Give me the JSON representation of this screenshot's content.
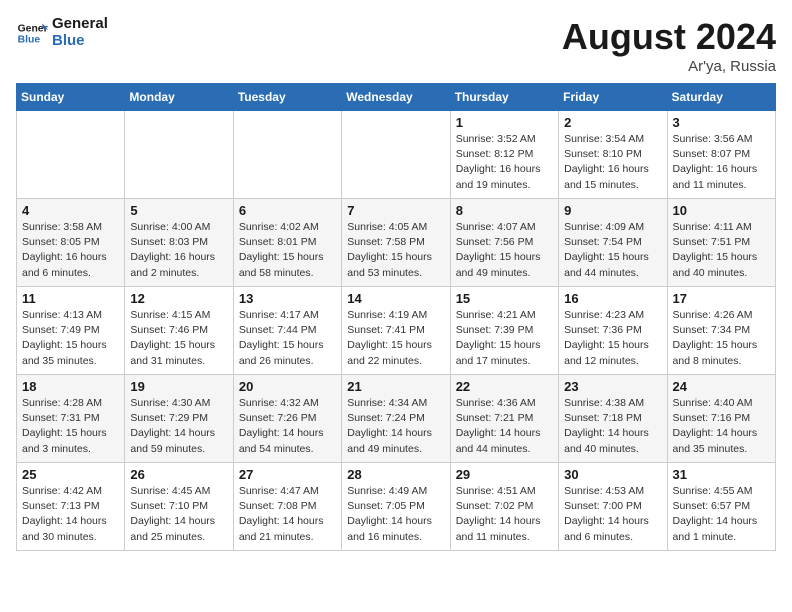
{
  "logo": {
    "line1": "General",
    "line2": "Blue"
  },
  "title": "August 2024",
  "subtitle": "Ar'ya, Russia",
  "weekdays": [
    "Sunday",
    "Monday",
    "Tuesday",
    "Wednesday",
    "Thursday",
    "Friday",
    "Saturday"
  ],
  "weeks": [
    [
      {
        "day": "",
        "info": ""
      },
      {
        "day": "",
        "info": ""
      },
      {
        "day": "",
        "info": ""
      },
      {
        "day": "",
        "info": ""
      },
      {
        "day": "1",
        "info": "Sunrise: 3:52 AM\nSunset: 8:12 PM\nDaylight: 16 hours\nand 19 minutes."
      },
      {
        "day": "2",
        "info": "Sunrise: 3:54 AM\nSunset: 8:10 PM\nDaylight: 16 hours\nand 15 minutes."
      },
      {
        "day": "3",
        "info": "Sunrise: 3:56 AM\nSunset: 8:07 PM\nDaylight: 16 hours\nand 11 minutes."
      }
    ],
    [
      {
        "day": "4",
        "info": "Sunrise: 3:58 AM\nSunset: 8:05 PM\nDaylight: 16 hours\nand 6 minutes."
      },
      {
        "day": "5",
        "info": "Sunrise: 4:00 AM\nSunset: 8:03 PM\nDaylight: 16 hours\nand 2 minutes."
      },
      {
        "day": "6",
        "info": "Sunrise: 4:02 AM\nSunset: 8:01 PM\nDaylight: 15 hours\nand 58 minutes."
      },
      {
        "day": "7",
        "info": "Sunrise: 4:05 AM\nSunset: 7:58 PM\nDaylight: 15 hours\nand 53 minutes."
      },
      {
        "day": "8",
        "info": "Sunrise: 4:07 AM\nSunset: 7:56 PM\nDaylight: 15 hours\nand 49 minutes."
      },
      {
        "day": "9",
        "info": "Sunrise: 4:09 AM\nSunset: 7:54 PM\nDaylight: 15 hours\nand 44 minutes."
      },
      {
        "day": "10",
        "info": "Sunrise: 4:11 AM\nSunset: 7:51 PM\nDaylight: 15 hours\nand 40 minutes."
      }
    ],
    [
      {
        "day": "11",
        "info": "Sunrise: 4:13 AM\nSunset: 7:49 PM\nDaylight: 15 hours\nand 35 minutes."
      },
      {
        "day": "12",
        "info": "Sunrise: 4:15 AM\nSunset: 7:46 PM\nDaylight: 15 hours\nand 31 minutes."
      },
      {
        "day": "13",
        "info": "Sunrise: 4:17 AM\nSunset: 7:44 PM\nDaylight: 15 hours\nand 26 minutes."
      },
      {
        "day": "14",
        "info": "Sunrise: 4:19 AM\nSunset: 7:41 PM\nDaylight: 15 hours\nand 22 minutes."
      },
      {
        "day": "15",
        "info": "Sunrise: 4:21 AM\nSunset: 7:39 PM\nDaylight: 15 hours\nand 17 minutes."
      },
      {
        "day": "16",
        "info": "Sunrise: 4:23 AM\nSunset: 7:36 PM\nDaylight: 15 hours\nand 12 minutes."
      },
      {
        "day": "17",
        "info": "Sunrise: 4:26 AM\nSunset: 7:34 PM\nDaylight: 15 hours\nand 8 minutes."
      }
    ],
    [
      {
        "day": "18",
        "info": "Sunrise: 4:28 AM\nSunset: 7:31 PM\nDaylight: 15 hours\nand 3 minutes."
      },
      {
        "day": "19",
        "info": "Sunrise: 4:30 AM\nSunset: 7:29 PM\nDaylight: 14 hours\nand 59 minutes."
      },
      {
        "day": "20",
        "info": "Sunrise: 4:32 AM\nSunset: 7:26 PM\nDaylight: 14 hours\nand 54 minutes."
      },
      {
        "day": "21",
        "info": "Sunrise: 4:34 AM\nSunset: 7:24 PM\nDaylight: 14 hours\nand 49 minutes."
      },
      {
        "day": "22",
        "info": "Sunrise: 4:36 AM\nSunset: 7:21 PM\nDaylight: 14 hours\nand 44 minutes."
      },
      {
        "day": "23",
        "info": "Sunrise: 4:38 AM\nSunset: 7:18 PM\nDaylight: 14 hours\nand 40 minutes."
      },
      {
        "day": "24",
        "info": "Sunrise: 4:40 AM\nSunset: 7:16 PM\nDaylight: 14 hours\nand 35 minutes."
      }
    ],
    [
      {
        "day": "25",
        "info": "Sunrise: 4:42 AM\nSunset: 7:13 PM\nDaylight: 14 hours\nand 30 minutes."
      },
      {
        "day": "26",
        "info": "Sunrise: 4:45 AM\nSunset: 7:10 PM\nDaylight: 14 hours\nand 25 minutes."
      },
      {
        "day": "27",
        "info": "Sunrise: 4:47 AM\nSunset: 7:08 PM\nDaylight: 14 hours\nand 21 minutes."
      },
      {
        "day": "28",
        "info": "Sunrise: 4:49 AM\nSunset: 7:05 PM\nDaylight: 14 hours\nand 16 minutes."
      },
      {
        "day": "29",
        "info": "Sunrise: 4:51 AM\nSunset: 7:02 PM\nDaylight: 14 hours\nand 11 minutes."
      },
      {
        "day": "30",
        "info": "Sunrise: 4:53 AM\nSunset: 7:00 PM\nDaylight: 14 hours\nand 6 minutes."
      },
      {
        "day": "31",
        "info": "Sunrise: 4:55 AM\nSunset: 6:57 PM\nDaylight: 14 hours\nand 1 minute."
      }
    ]
  ]
}
